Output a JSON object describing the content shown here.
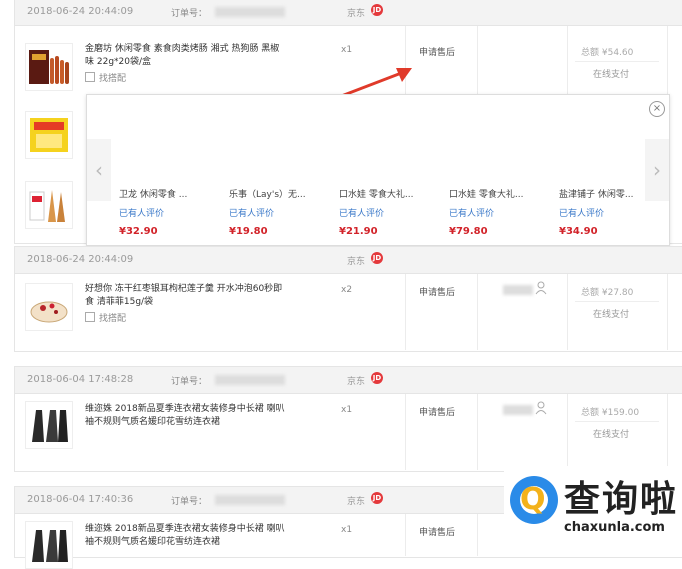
{
  "colors": {
    "accent_red": "#d2232a",
    "link_blue": "#3a78c9",
    "jd_red": "#e4393c",
    "logo_blue": "#2a8be8",
    "logo_yellow": "#f3b21b"
  },
  "labels": {
    "order_no": "订单号：",
    "shop": "京东",
    "jd_badge": "JD",
    "after_sale": "申请售后",
    "find_match": "找搭配",
    "pay_online": "在线支付"
  },
  "orders": [
    {
      "date": "2018-06-24 20:44:09",
      "product": "金磨坊 休闲零食 素食肉类烤肠 湘式 热狗肠 黑椒味 22g*20袋/盒",
      "qty": "x1",
      "total": "总额 ¥54.60"
    },
    {
      "date": "2018-06-24 20:44:09",
      "product": "好想你 冻干红枣银耳枸杞莲子羹 开水冲泡60秒即食 清菲菲15g/袋",
      "qty": "x2",
      "total": "总额 ¥27.80"
    },
    {
      "date": "2018-06-04 17:48:28",
      "product": "维迩姝 2018新品夏季连衣裙女装修身中长裙 喇叭袖不规则气质名媛印花雪纺连衣裙",
      "qty": "x1",
      "total": "总额 ¥159.00"
    },
    {
      "date": "2018-06-04 17:40:36",
      "product": "维迩姝 2018新品夏季连衣裙女装修身中长裙 喇叭袖不规则气质名媛印花雪纺连衣裙",
      "qty": "x1",
      "total": ""
    }
  ],
  "popup": {
    "prev": "‹",
    "next": "›",
    "close": "×",
    "items": [
      {
        "name": "卫龙 休闲零食 ...",
        "reviews": "已有人评价",
        "price": "¥32.90"
      },
      {
        "name": "乐事（Lay's）无...",
        "reviews": "已有人评价",
        "price": "¥19.80"
      },
      {
        "name": "口水娃 零食大礼...",
        "reviews": "已有人评价",
        "price": "¥21.90"
      },
      {
        "name": "口水娃 零食大礼...",
        "reviews": "已有人评价",
        "price": "¥79.80"
      },
      {
        "name": "盐津铺子 休闲零...",
        "reviews": "已有人评价",
        "price": "¥34.90"
      }
    ]
  },
  "watermark": {
    "brand": "查询啦",
    "url": "chaxunla.com",
    "icon_glyph": "Q"
  }
}
